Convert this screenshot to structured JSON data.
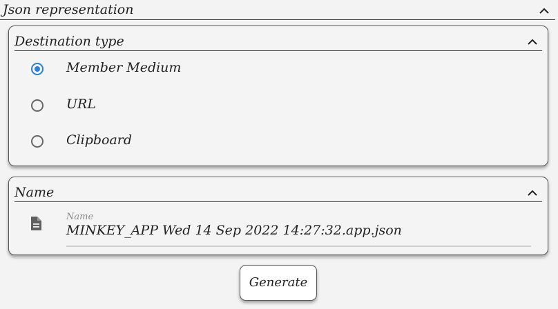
{
  "json_section": {
    "title": "Json representation"
  },
  "destination": {
    "title": "Destination type",
    "options": [
      {
        "label": "Member Medium",
        "selected": true
      },
      {
        "label": "URL",
        "selected": false
      },
      {
        "label": "Clipboard",
        "selected": false
      }
    ]
  },
  "name_section": {
    "title": "Name",
    "field_label": "Name",
    "field_value": "MINKEY_APP Wed 14 Sep 2022 14:27:32.app.json",
    "icon": "file-icon"
  },
  "actions": {
    "generate_label": "Generate"
  },
  "colors": {
    "accent": "#2b7fd4",
    "background": "#f3f3f3"
  }
}
